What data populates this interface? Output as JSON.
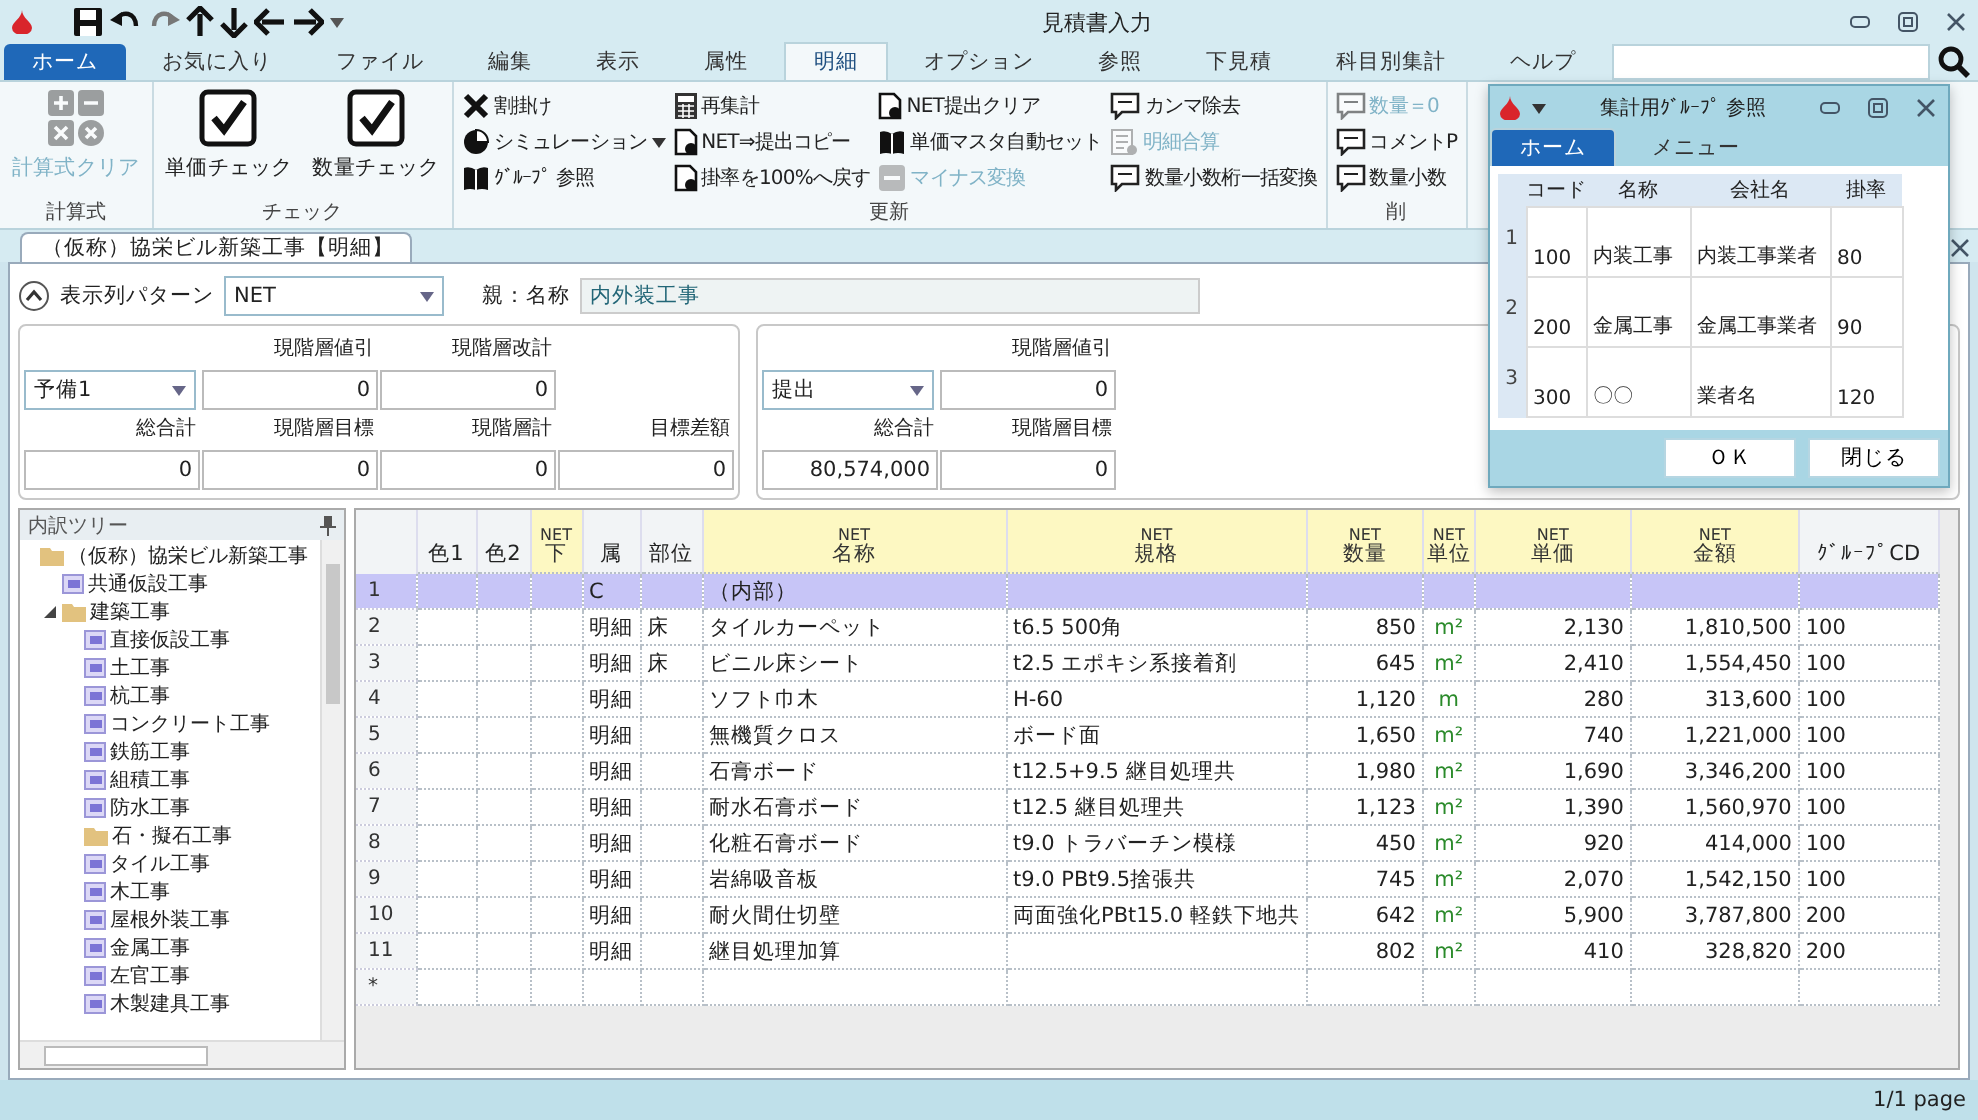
{
  "window": {
    "title": "見積書入力"
  },
  "ribbon_tabs": [
    {
      "label": "ホーム",
      "kind": "app",
      "selected": false
    },
    {
      "label": "お気に入り",
      "kind": "tab",
      "selected": false
    },
    {
      "label": "ファイル",
      "kind": "tab",
      "selected": false
    },
    {
      "label": "編集",
      "kind": "tab",
      "selected": false
    },
    {
      "label": "表示",
      "kind": "tab",
      "selected": false
    },
    {
      "label": "属性",
      "kind": "tab",
      "selected": false
    },
    {
      "label": "明細",
      "kind": "tab",
      "selected": true
    },
    {
      "label": "オプション",
      "kind": "tab",
      "selected": false
    },
    {
      "label": "参照",
      "kind": "tab",
      "selected": false
    },
    {
      "label": "下見積",
      "kind": "tab",
      "selected": false
    },
    {
      "label": "科目別集計",
      "kind": "tab",
      "selected": false
    },
    {
      "label": "ヘルプ",
      "kind": "tab",
      "selected": false
    }
  ],
  "ribbon_groups": [
    {
      "label": "計算式",
      "items": [
        {
          "label": "計算式クリア",
          "kind": "large",
          "disabled": true
        }
      ]
    },
    {
      "label": "チェック",
      "items": [
        {
          "label": "単価チェック",
          "kind": "large",
          "disabled": false
        },
        {
          "label": "数量チェック",
          "kind": "large",
          "disabled": false
        }
      ]
    },
    {
      "label": "更新",
      "items": [
        {
          "label": "割掛け",
          "kind": "small",
          "disabled": false
        },
        {
          "label": "シミュレーション",
          "kind": "dropdown",
          "disabled": false
        },
        {
          "label": "ｸﾞﾙｰﾌﾟ 参照",
          "kind": "small",
          "disabled": false
        },
        {
          "label": "再集計",
          "kind": "small",
          "disabled": false
        },
        {
          "label": "NET⇒提出コピー",
          "kind": "small",
          "disabled": false
        },
        {
          "label": "掛率を100%へ戻す",
          "kind": "small",
          "disabled": false
        },
        {
          "label": "NET提出クリア",
          "kind": "small",
          "disabled": false
        },
        {
          "label": "単価マスタ自動セット",
          "kind": "small",
          "disabled": false
        },
        {
          "label": "マイナス変換",
          "kind": "small",
          "disabled": true
        },
        {
          "label": "カンマ除去",
          "kind": "small",
          "disabled": false
        },
        {
          "label": "明細合算",
          "kind": "small",
          "disabled": true
        },
        {
          "label": "数量小数桁一括変換",
          "kind": "small",
          "disabled": false
        }
      ]
    },
    {
      "label": "削",
      "items": [
        {
          "label": "数量＝0",
          "kind": "small",
          "disabled": true
        },
        {
          "label": "コメントP",
          "kind": "small",
          "disabled": false
        },
        {
          "label": "数量小数",
          "kind": "small",
          "disabled": false
        }
      ]
    }
  ],
  "document_tab": {
    "label": "（仮称）協栄ビル新築工事【明細】"
  },
  "pattern": {
    "label": "表示列パターン",
    "value": "NET"
  },
  "parent": {
    "label": "親：名称",
    "value": "内外装工事"
  },
  "summary_panels": [
    {
      "dropdown": "予備1",
      "top_fields": [
        {
          "label": "現階層値引",
          "value": "0"
        },
        {
          "label": "現階層改計",
          "value": "0"
        }
      ],
      "bottom_fields": [
        {
          "label": "総合計",
          "value": "0"
        },
        {
          "label": "現階層目標",
          "value": "0"
        },
        {
          "label": "現階層計",
          "value": "0"
        },
        {
          "label": "目標差額",
          "value": "0"
        }
      ]
    },
    {
      "dropdown": "提出",
      "top_fields": [
        {
          "label": "現階層値引",
          "value": "0"
        }
      ],
      "bottom_fields": [
        {
          "label": "総合計",
          "value": "80,574,000"
        },
        {
          "label": "現階層目標",
          "value": "0"
        }
      ]
    }
  ],
  "tree": {
    "title": "内訳ツリー",
    "items": [
      {
        "label": "（仮称）協栄ビル新築工事",
        "kind": "folder",
        "children": [
          {
            "label": "共通仮設工事",
            "kind": "item"
          },
          {
            "label": "建築工事",
            "kind": "folder",
            "expanded": true,
            "children": [
              {
                "label": "直接仮設工事",
                "kind": "item"
              },
              {
                "label": "土工事",
                "kind": "item"
              },
              {
                "label": "杭工事",
                "kind": "item"
              },
              {
                "label": "コンクリート工事",
                "kind": "item"
              },
              {
                "label": "鉄筋工事",
                "kind": "item"
              },
              {
                "label": "組積工事",
                "kind": "item"
              },
              {
                "label": "防水工事",
                "kind": "item"
              },
              {
                "label": "石・擬石工事",
                "kind": "folder"
              },
              {
                "label": "タイル工事",
                "kind": "item"
              },
              {
                "label": "木工事",
                "kind": "item"
              },
              {
                "label": "屋根外装工事",
                "kind": "item"
              },
              {
                "label": "金属工事",
                "kind": "item"
              },
              {
                "label": "左官工事",
                "kind": "item"
              },
              {
                "label": "木製建具工事",
                "kind": "item"
              }
            ]
          }
        ]
      }
    ]
  },
  "table": {
    "columns": [
      {
        "label": "色1",
        "kind": "text",
        "highlighted": false
      },
      {
        "label": "色2",
        "kind": "text",
        "highlighted": false
      },
      {
        "prefix": "NET",
        "label": "下",
        "kind": "text",
        "highlighted": true
      },
      {
        "label": "属",
        "kind": "text",
        "highlighted": false
      },
      {
        "label": "部位",
        "kind": "text",
        "highlighted": false
      },
      {
        "prefix": "NET",
        "label": "名称",
        "kind": "text",
        "highlighted": true
      },
      {
        "prefix": "NET",
        "label": "規格",
        "kind": "text",
        "highlighted": true
      },
      {
        "prefix": "NET",
        "label": "数量",
        "kind": "number",
        "highlighted": true
      },
      {
        "prefix": "NET",
        "label": "単位",
        "kind": "unit",
        "highlighted": true
      },
      {
        "prefix": "NET",
        "label": "単価",
        "kind": "number",
        "highlighted": true
      },
      {
        "prefix": "NET",
        "label": "金額",
        "kind": "number",
        "highlighted": true
      },
      {
        "label": "ｸﾞﾙｰﾌﾟCD",
        "kind": "text",
        "highlighted": false
      }
    ],
    "rows": [
      {
        "num": "1",
        "selected": true,
        "cells": {
          "attr": "C",
          "name": "（内部）"
        }
      },
      {
        "num": "2",
        "selected": false,
        "cells": {
          "attr": "明細",
          "part": "床",
          "name": "タイルカーペット",
          "spec": "t6.5 500角",
          "qty": "850",
          "unit": "m²",
          "price": "2,130",
          "amount": "1,810,500",
          "group_cd": "100"
        }
      },
      {
        "num": "3",
        "selected": false,
        "cells": {
          "attr": "明細",
          "part": "床",
          "name": "ビニル床シート",
          "spec": "t2.5 エポキシ系接着剤",
          "qty": "645",
          "unit": "m²",
          "price": "2,410",
          "amount": "1,554,450",
          "group_cd": "100"
        }
      },
      {
        "num": "4",
        "selected": false,
        "cells": {
          "attr": "明細",
          "name": "ソフト巾木",
          "spec": "H-60",
          "qty": "1,120",
          "unit": "m",
          "price": "280",
          "amount": "313,600",
          "group_cd": "100"
        }
      },
      {
        "num": "5",
        "selected": false,
        "cells": {
          "attr": "明細",
          "name": "無機質クロス",
          "spec": "ボード面",
          "qty": "1,650",
          "unit": "m²",
          "price": "740",
          "amount": "1,221,000",
          "group_cd": "100"
        }
      },
      {
        "num": "6",
        "selected": false,
        "cells": {
          "attr": "明細",
          "name": "石膏ボード",
          "spec": "t12.5+9.5 継目処理共",
          "qty": "1,980",
          "unit": "m²",
          "price": "1,690",
          "amount": "3,346,200",
          "group_cd": "100"
        }
      },
      {
        "num": "7",
        "selected": false,
        "cells": {
          "attr": "明細",
          "name": "耐水石膏ボード",
          "spec": "t12.5 継目処理共",
          "qty": "1,123",
          "unit": "m²",
          "price": "1,390",
          "amount": "1,560,970",
          "group_cd": "100"
        }
      },
      {
        "num": "8",
        "selected": false,
        "cells": {
          "attr": "明細",
          "name": "化粧石膏ボード",
          "spec": "t9.0 トラバーチン模様",
          "qty": "450",
          "unit": "m²",
          "price": "920",
          "amount": "414,000",
          "group_cd": "100"
        }
      },
      {
        "num": "9",
        "selected": false,
        "cells": {
          "attr": "明細",
          "name": "岩綿吸音板",
          "spec": "t9.0 PBt9.5捨張共",
          "qty": "745",
          "unit": "m²",
          "price": "2,070",
          "amount": "1,542,150",
          "group_cd": "100"
        }
      },
      {
        "num": "10",
        "selected": false,
        "cells": {
          "attr": "明細",
          "name": "耐火間仕切壁",
          "spec": "両面強化PBt15.0 軽鉄下地共",
          "qty": "642",
          "unit": "m²",
          "price": "5,900",
          "amount": "3,787,800",
          "group_cd": "200"
        }
      },
      {
        "num": "11",
        "selected": false,
        "cells": {
          "attr": "明細",
          "name": "継目処理加算",
          "qty": "802",
          "unit": "m²",
          "price": "410",
          "amount": "328,820",
          "group_cd": "200"
        }
      },
      {
        "num": "*",
        "selected": false,
        "cells": {}
      }
    ]
  },
  "dialog": {
    "title": "集計用ｸﾞﾙｰﾌﾟ 参照",
    "tabs": [
      {
        "label": "ホーム",
        "kind": "app",
        "selected": true
      },
      {
        "label": "メニュー",
        "kind": "tab",
        "selected": false
      }
    ],
    "table": {
      "columns": [
        "コード",
        "名称",
        "会社名",
        "掛率"
      ],
      "rows": [
        {
          "num": "1",
          "cells": [
            "100",
            "内装工事",
            "内装工事業者",
            "80"
          ]
        },
        {
          "num": "2",
          "cells": [
            "200",
            "金属工事",
            "金属工事業者",
            "90"
          ]
        },
        {
          "num": "3",
          "cells": [
            "300",
            "〇〇",
            "業者名",
            "120"
          ]
        }
      ]
    },
    "buttons": [
      "ＯＫ",
      "閉じる"
    ]
  },
  "status_bar": {
    "page": "1/1 page"
  }
}
